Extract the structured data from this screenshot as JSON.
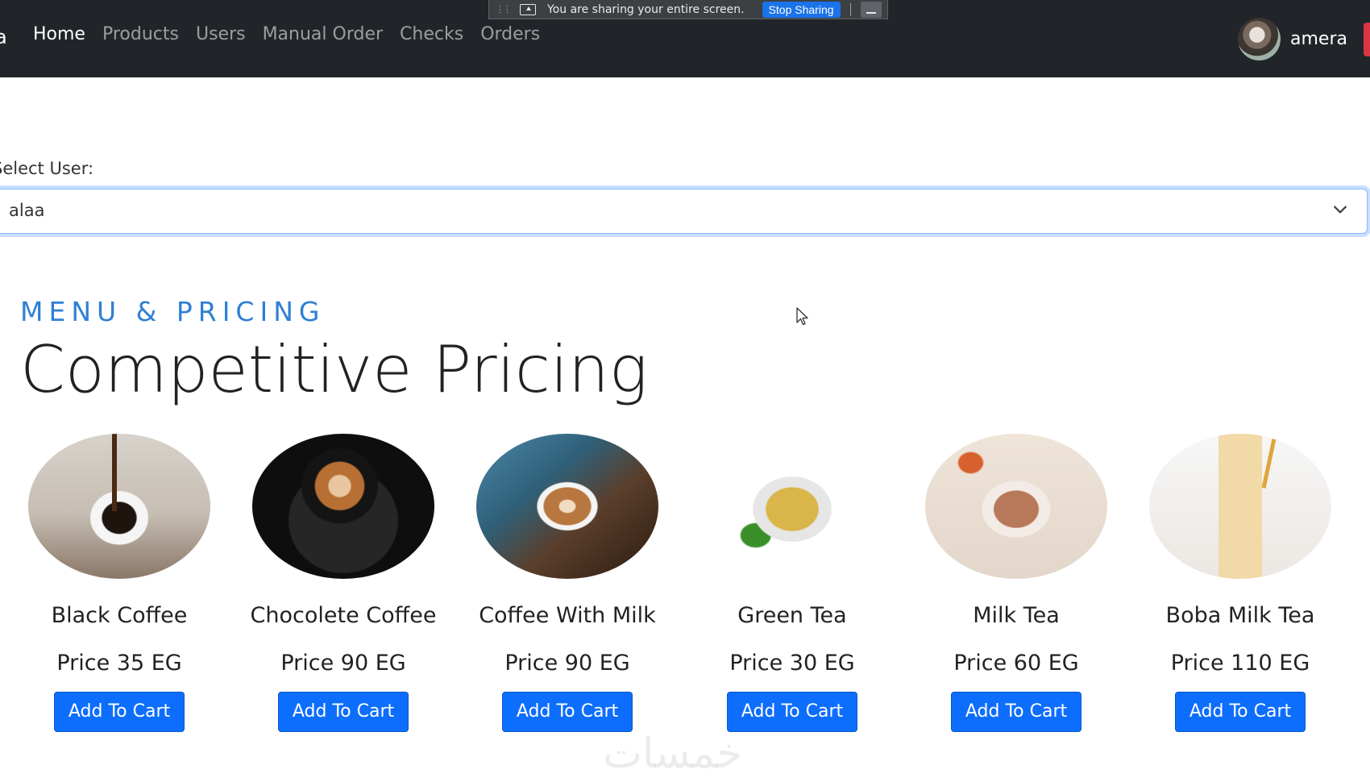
{
  "navbar": {
    "brand_fragment": "a",
    "links": [
      {
        "label": "Home"
      },
      {
        "label": "Products"
      },
      {
        "label": "Users"
      },
      {
        "label": "Manual Order"
      },
      {
        "label": "Checks"
      },
      {
        "label": "Orders"
      }
    ],
    "active_link": "Home",
    "user_name": "amera"
  },
  "screen_share": {
    "message": "You are sharing your entire screen.",
    "stop_label": "Stop Sharing"
  },
  "select_user": {
    "label": "Select User:",
    "value": "alaa"
  },
  "section": {
    "eyebrow": "MENU & PRICING",
    "title": "Competitive Pricing"
  },
  "products": [
    {
      "name": "Black Coffee",
      "price": "Price 35 EG",
      "button": "Add To Cart",
      "image": "black-coffee"
    },
    {
      "name": "Chocolete Coffee",
      "price": "Price 90 EG",
      "button": "Add To Cart",
      "image": "chocolate-coffee"
    },
    {
      "name": "Coffee With Milk",
      "price": "Price 90 EG",
      "button": "Add To Cart",
      "image": "coffee-with-milk"
    },
    {
      "name": "Green Tea",
      "price": "Price 30 EG",
      "button": "Add To Cart",
      "image": "green-tea"
    },
    {
      "name": "Milk Tea",
      "price": "Price 60 EG",
      "button": "Add To Cart",
      "image": "milk-tea"
    },
    {
      "name": "Boba Milk Tea",
      "price": "Price 110 EG",
      "button": "Add To Cart",
      "image": "boba-milk-tea"
    }
  ],
  "watermark": "خمسات",
  "colors": {
    "navbar_bg": "#212529",
    "accent_blue": "#0d6efd",
    "eyebrow_blue": "#2f7fd3",
    "danger": "#dc3545"
  }
}
